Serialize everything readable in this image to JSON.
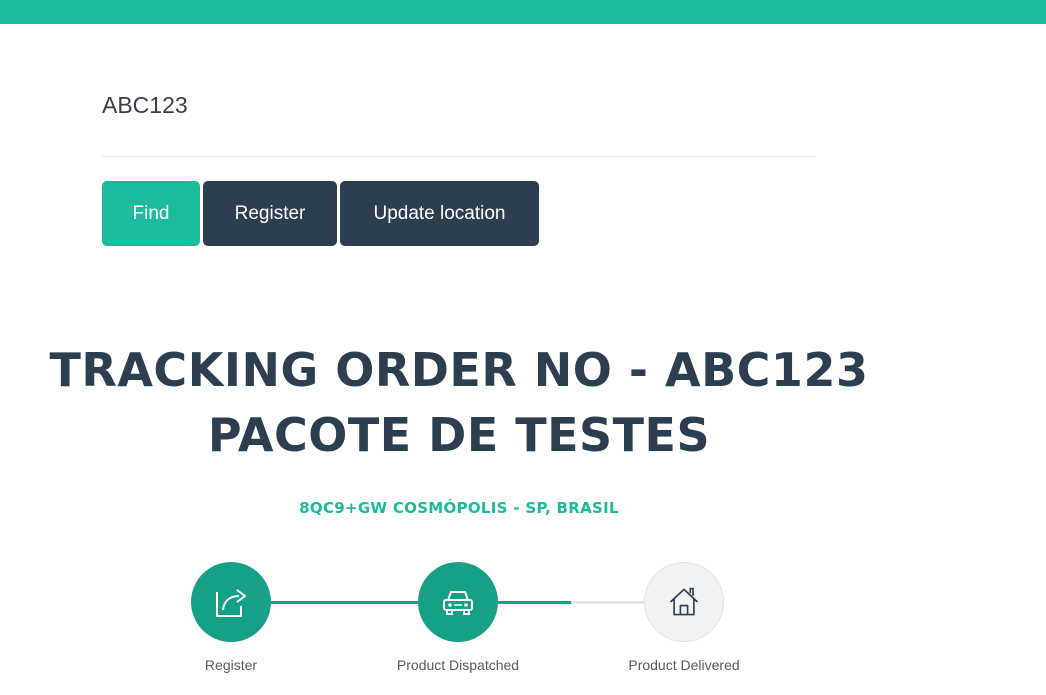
{
  "search": {
    "value": "ABC123"
  },
  "actions": {
    "find_label": "Find",
    "register_label": "Register",
    "update_label": "Update location"
  },
  "tracking": {
    "title_line1": "TRACKING ORDER NO - ABC123",
    "title_line2": "PACOTE DE TESTES",
    "location": "8QC9+GW COSMÓPOLIS - SP, BRASIL",
    "progress_fraction": 0.75,
    "steps": [
      {
        "label": "Register",
        "icon": "share-icon",
        "status": "done"
      },
      {
        "label": "Product Dispatched",
        "icon": "car-icon",
        "status": "done"
      },
      {
        "label": "Product Delivered",
        "icon": "home-icon",
        "status": "pending"
      }
    ]
  },
  "colors": {
    "accent": "#1abc9c",
    "dark": "#2c3e50",
    "step_done": "#16a085",
    "step_pending": "#f2f2f2"
  }
}
